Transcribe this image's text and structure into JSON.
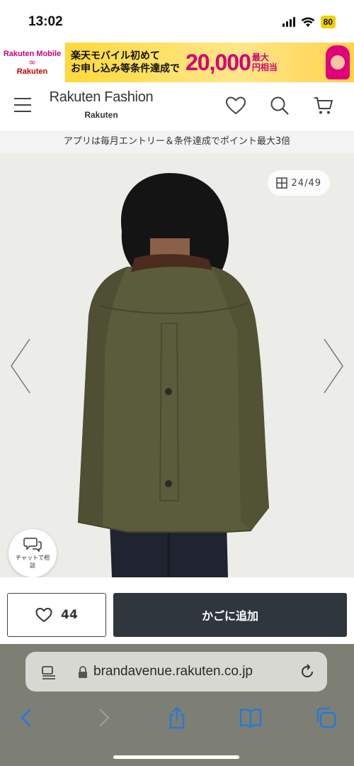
{
  "status_bar": {
    "time": "13:02",
    "battery": "80"
  },
  "ad_banner": {
    "brand_top": "Rakuten Mobile",
    "brand_bottom": "Rakuten",
    "line1": "楽天モバイル初めて",
    "line2": "お申し込み等条件達成で",
    "amount": "20,000",
    "unit_line1": "最大",
    "unit_line2": "円相当"
  },
  "header": {
    "logo_main": "Rakuten Fashion",
    "logo_sub": "Rakuten",
    "icons": [
      "menu-icon",
      "heart-icon",
      "search-icon",
      "cart-icon"
    ]
  },
  "promo": {
    "text": "アプリは毎月エントリー＆条件達成でポイント最大3倍"
  },
  "gallery": {
    "counter": "24/49",
    "chat_label": "チャットで相談"
  },
  "actions": {
    "favorite_count": "44",
    "add_to_cart_label": "かごに追加"
  },
  "browser": {
    "url": "brandavenue.rakuten.co.jp"
  },
  "colors": {
    "cart_button": "#2f363d",
    "jacket": "#5b5c3c",
    "collar": "#4a2b1e",
    "browser_chrome": "#7d7e74"
  }
}
